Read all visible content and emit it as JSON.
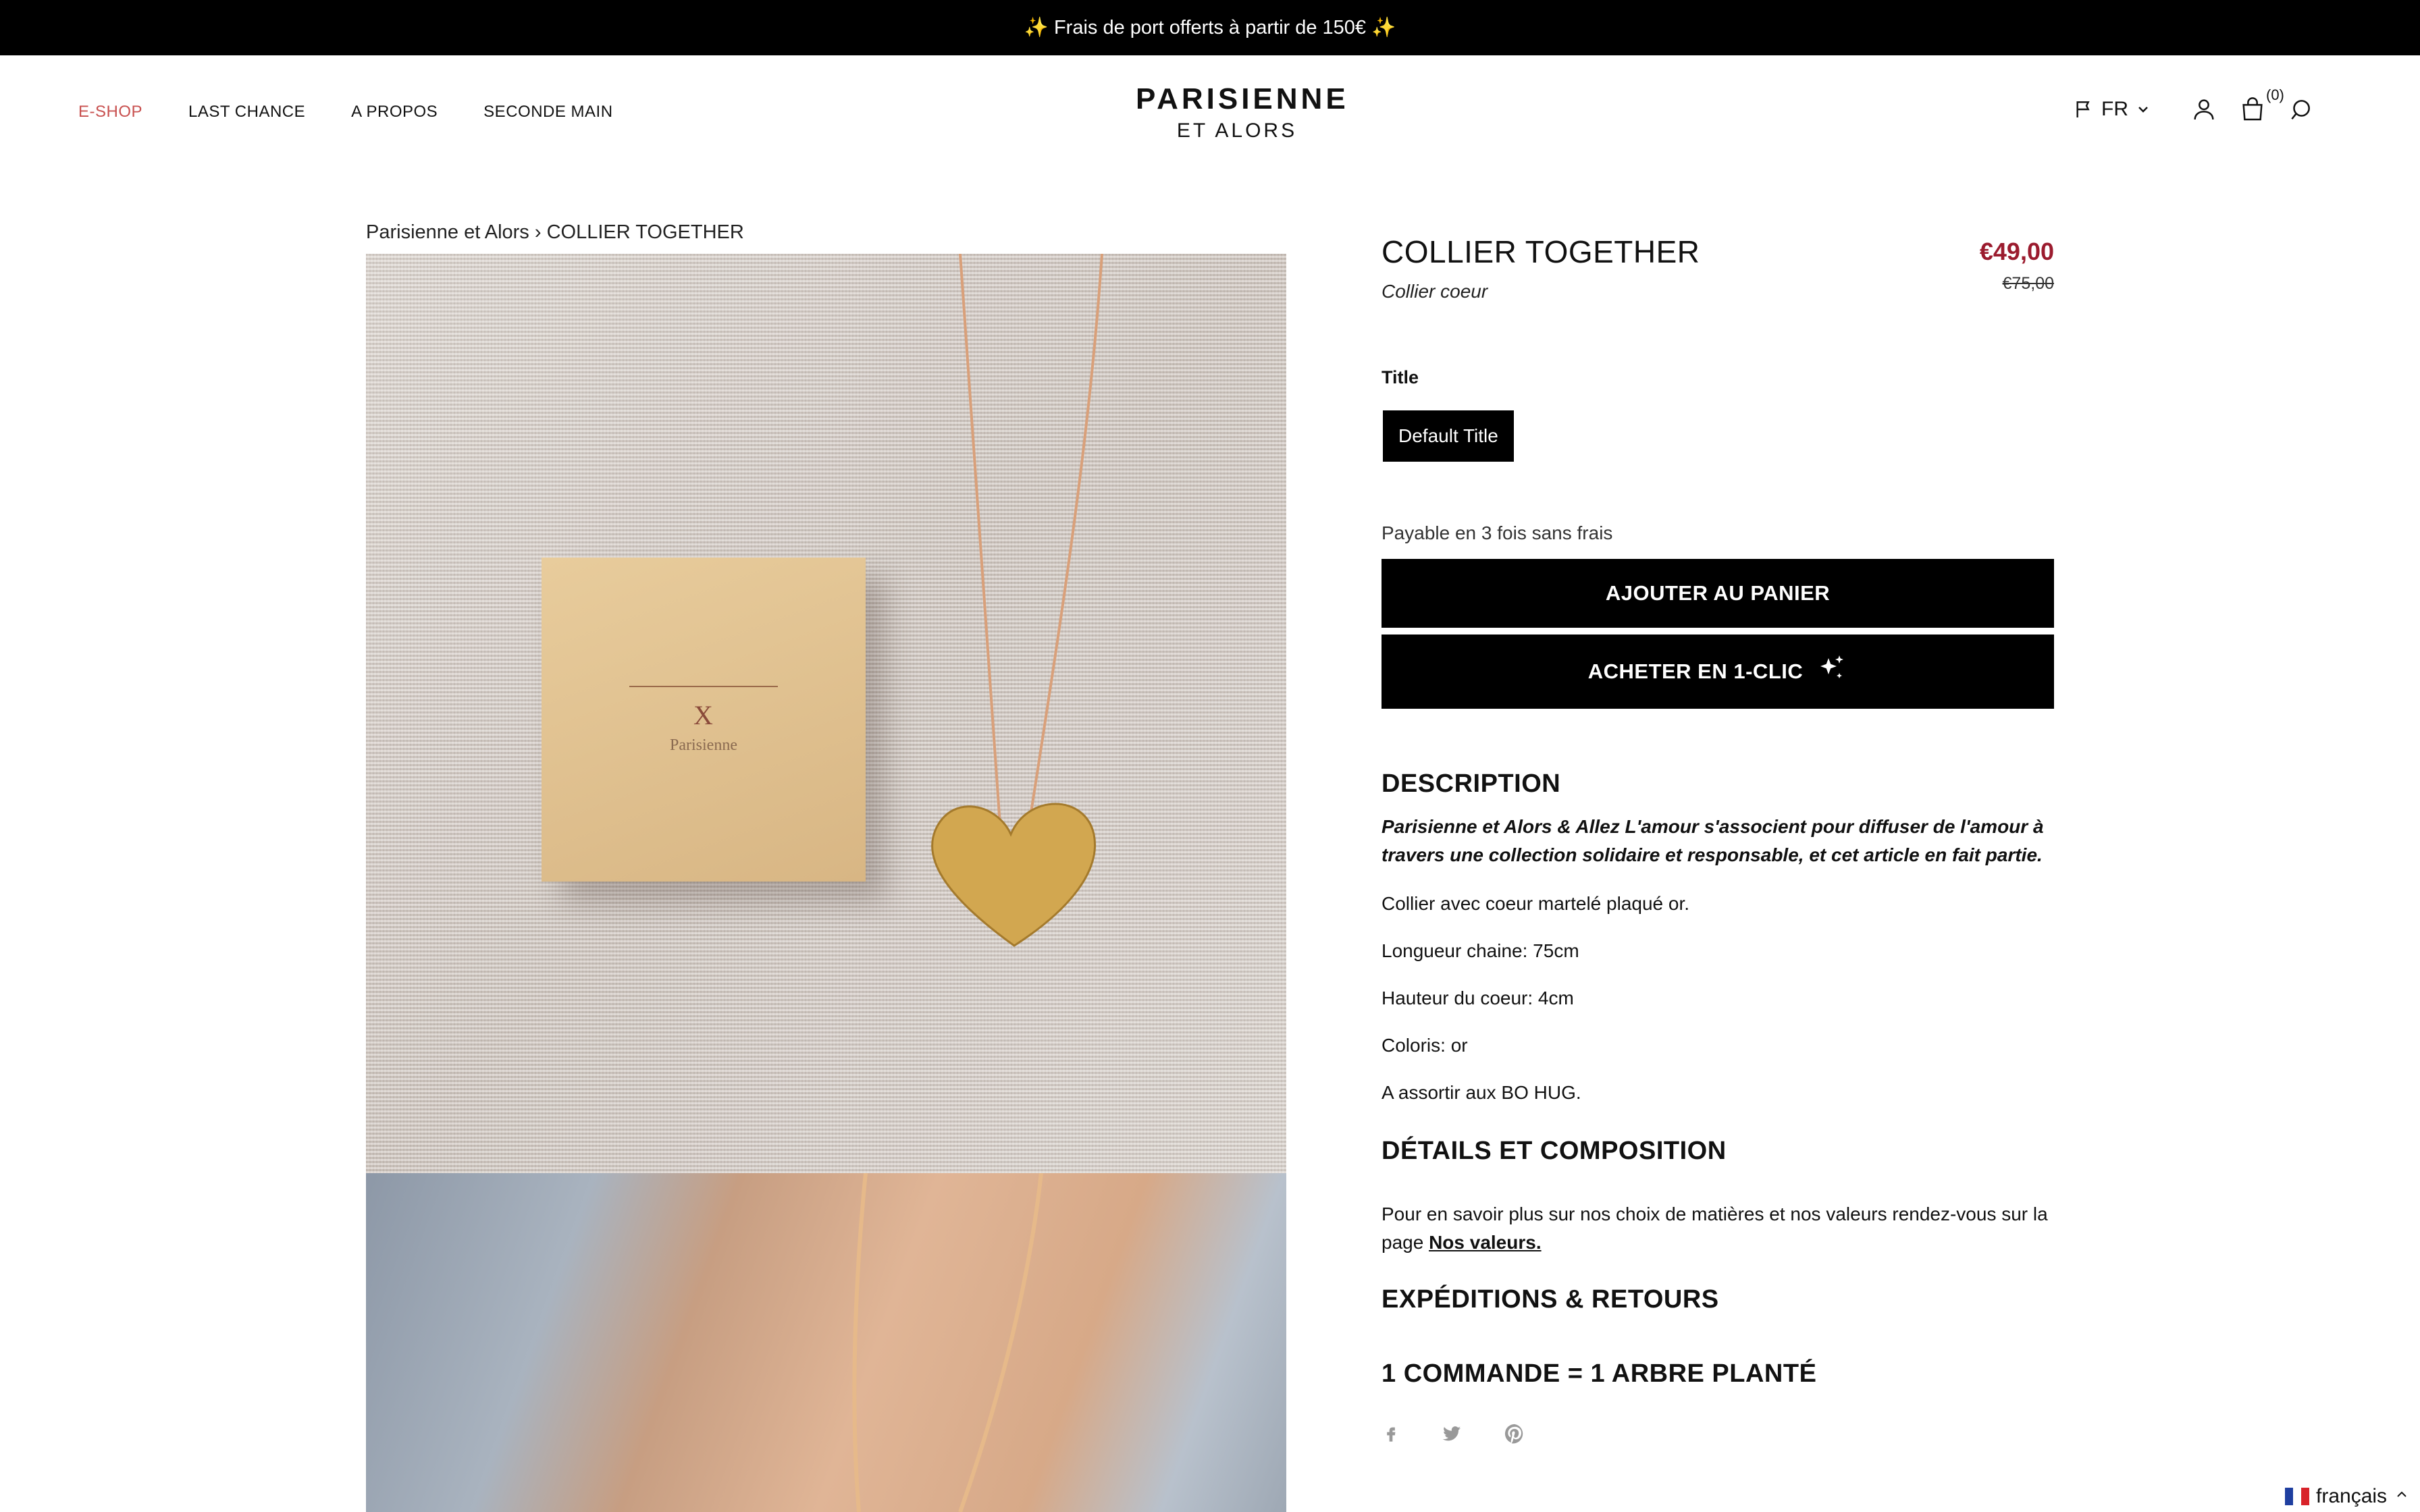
{
  "announcement": "✨ Frais de port offerts à partir de 150€ ✨",
  "nav": {
    "items": [
      {
        "label": "E-SHOP",
        "active": true
      },
      {
        "label": "LAST CHANCE"
      },
      {
        "label": "A PROPOS"
      },
      {
        "label": "SECONDE MAIN"
      }
    ]
  },
  "logo": {
    "line1": "PARISIENNE",
    "line2": "ET ALORS"
  },
  "header_right": {
    "language": "FR",
    "cart_count": "(0)",
    "icons": [
      "flag-icon",
      "chevron-down-icon",
      "account-icon",
      "cart-icon",
      "search-icon"
    ]
  },
  "breadcrumb": {
    "home": "Parisienne et Alors",
    "separator": "›",
    "current": "COLLIER TOGETHER"
  },
  "gallery": {
    "image1": {
      "box_mark": "X",
      "box_brand": "Parisienne"
    }
  },
  "product": {
    "title": "COLLIER TOGETHER",
    "subtitle": "Collier coeur",
    "price": "€49,00",
    "compare_price": "€75,00",
    "option_label": "Title",
    "option_value": "Default Title",
    "installments": "Payable en 3 fois sans frais",
    "add_to_cart": "AJOUTER AU PANIER",
    "buy_now": "ACHETER EN 1-CLIC"
  },
  "description": {
    "heading": "DESCRIPTION",
    "intro": "Parisienne et Alors & Allez L'amour s'associent pour diffuser de l'amour à travers une collection solidaire et responsable, et cet article en fait partie.",
    "lines": [
      "Collier avec coeur martelé plaqué or.",
      "Longueur chaine: 75cm",
      "Hauteur du coeur: 4cm",
      "Coloris: or",
      "A assortir aux BO HUG."
    ]
  },
  "details": {
    "heading": "DÉTAILS ET COMPOSITION",
    "text": "Pour en savoir plus sur nos choix de matières et nos valeurs rendez-vous sur la page ",
    "link": "Nos valeurs."
  },
  "shipping": {
    "heading": "EXPÉDITIONS & RETOURS"
  },
  "tree": {
    "heading": "1 COMMANDE = 1 ARBRE PLANTÉ"
  },
  "share": [
    "facebook-icon",
    "twitter-icon",
    "pinterest-icon"
  ],
  "language_switcher": {
    "label": "français"
  },
  "colors": {
    "accent_price": "#9b1b2e",
    "nav_active": "#c8504f",
    "button": "#000000"
  }
}
